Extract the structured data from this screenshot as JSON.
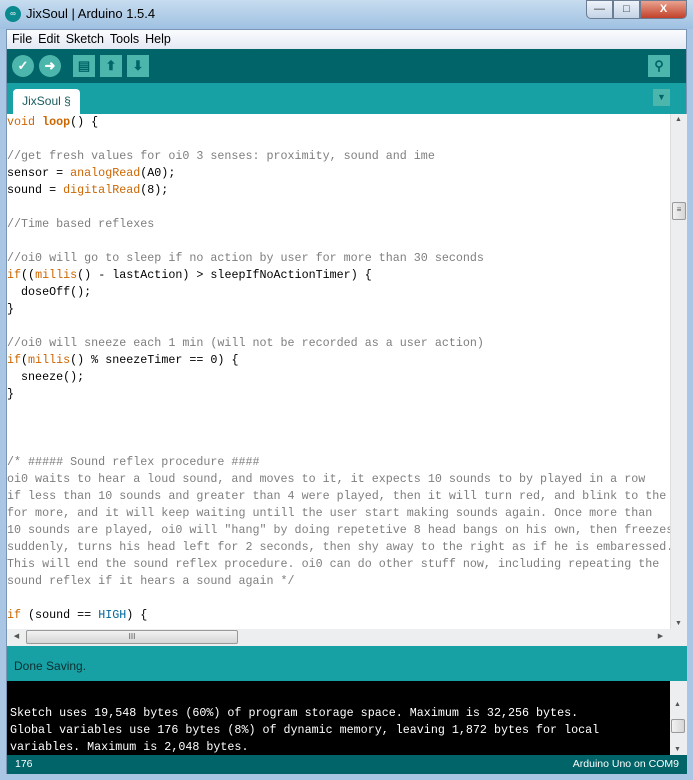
{
  "window": {
    "title": "JixSoul | Arduino 1.5.4",
    "icon": "arduino-logo-icon",
    "buttons": {
      "minimize": "—",
      "maximize": "□",
      "close": "X"
    }
  },
  "menu": [
    "File",
    "Edit",
    "Sketch",
    "Tools",
    "Help"
  ],
  "toolbar": {
    "verify": "✓",
    "upload": "➜",
    "new": "▤",
    "open": "⬆",
    "save": "⬇",
    "serial_monitor": "⚲"
  },
  "tab": {
    "label": "JixSoul §",
    "menu": "▼"
  },
  "colors": {
    "toolbar": "#006468",
    "tabbar": "#17a1a5",
    "keyword": "#cc6600",
    "constant": "#006699",
    "comment": "#7e7e7e"
  },
  "code": [
    [
      [
        "void",
        "kw"
      ],
      [
        " ",
        ""
      ],
      [
        "loop",
        "fn b"
      ],
      [
        "() {",
        ""
      ]
    ],
    [],
    [
      [
        "//get fresh values for oi0 3 senses: proximity, sound and ime",
        "cm"
      ]
    ],
    [
      [
        "sensor = ",
        ""
      ],
      [
        "analogRead",
        "fn"
      ],
      [
        "(A0);",
        ""
      ]
    ],
    [
      [
        "sound = ",
        ""
      ],
      [
        "digitalRead",
        "fn"
      ],
      [
        "(8);",
        ""
      ]
    ],
    [],
    [
      [
        "//Time based reflexes",
        "cm"
      ]
    ],
    [],
    [
      [
        "//oi0 will go to sleep if no action by user for more than 30 seconds",
        "cm"
      ]
    ],
    [
      [
        "if",
        "kw"
      ],
      [
        "((",
        ""
      ],
      [
        "millis",
        "fn"
      ],
      [
        "() - lastAction) > sleepIfNoActionTimer) {",
        ""
      ]
    ],
    [
      [
        "  doseOff();",
        ""
      ]
    ],
    [
      [
        "}",
        ""
      ]
    ],
    [],
    [
      [
        "//oi0 will sneeze each 1 min (will not be recorded as a user action)",
        "cm"
      ]
    ],
    [
      [
        "if",
        "kw"
      ],
      [
        "(",
        ""
      ],
      [
        "millis",
        "fn"
      ],
      [
        "() % sneezeTimer == 0) {",
        ""
      ]
    ],
    [
      [
        "  sneeze();",
        ""
      ]
    ],
    [
      [
        "}",
        ""
      ]
    ],
    [],
    [],
    [],
    [
      [
        "/* ##### Sound reflex procedure ####",
        "cm"
      ]
    ],
    [
      [
        "oi0 waits to hear a loud sound, and moves to it, it expects 10 sounds to by played in a row",
        "cm"
      ]
    ],
    [
      [
        "if less than 10 sounds and greater than 4 were played, then it will turn red, and blink to the",
        "cm"
      ]
    ],
    [
      [
        "for more, and it will keep waiting untill the user start making sounds again. Once more than",
        "cm"
      ]
    ],
    [
      [
        "10 sounds are played, oi0 will \"hang\" by doing repetetive 8 head bangs on his own, then freezes",
        "cm"
      ]
    ],
    [
      [
        "suddenly, turns his head left for 2 seconds, then shy away to the right as if he is embaressed.",
        "cm"
      ]
    ],
    [
      [
        "This will end the sound reflex procedure. oi0 can do other stuff now, including repeating the",
        "cm"
      ]
    ],
    [
      [
        "sound reflex if it hears a sound again */",
        "cm"
      ]
    ],
    [],
    [
      [
        "if",
        "kw"
      ],
      [
        " (sound == ",
        ""
      ],
      [
        "HIGH",
        "const"
      ],
      [
        ") {",
        ""
      ]
    ]
  ],
  "status": "Done Saving.",
  "console": [
    "Sketch uses 19,548 bytes (60%) of program storage space. Maximum is 32,256 bytes.",
    "Global variables use 176 bytes (8%) of dynamic memory, leaving 1,872 bytes for local",
    "variables. Maximum is 2,048 bytes."
  ],
  "footer": {
    "line": "176",
    "board": "Arduino Uno on COM9"
  },
  "scroll": {
    "thumb_grip": "≡",
    "h_thumb_grip": "III",
    "up": "▲",
    "down": "▼",
    "left": "◀",
    "right": "▶"
  }
}
